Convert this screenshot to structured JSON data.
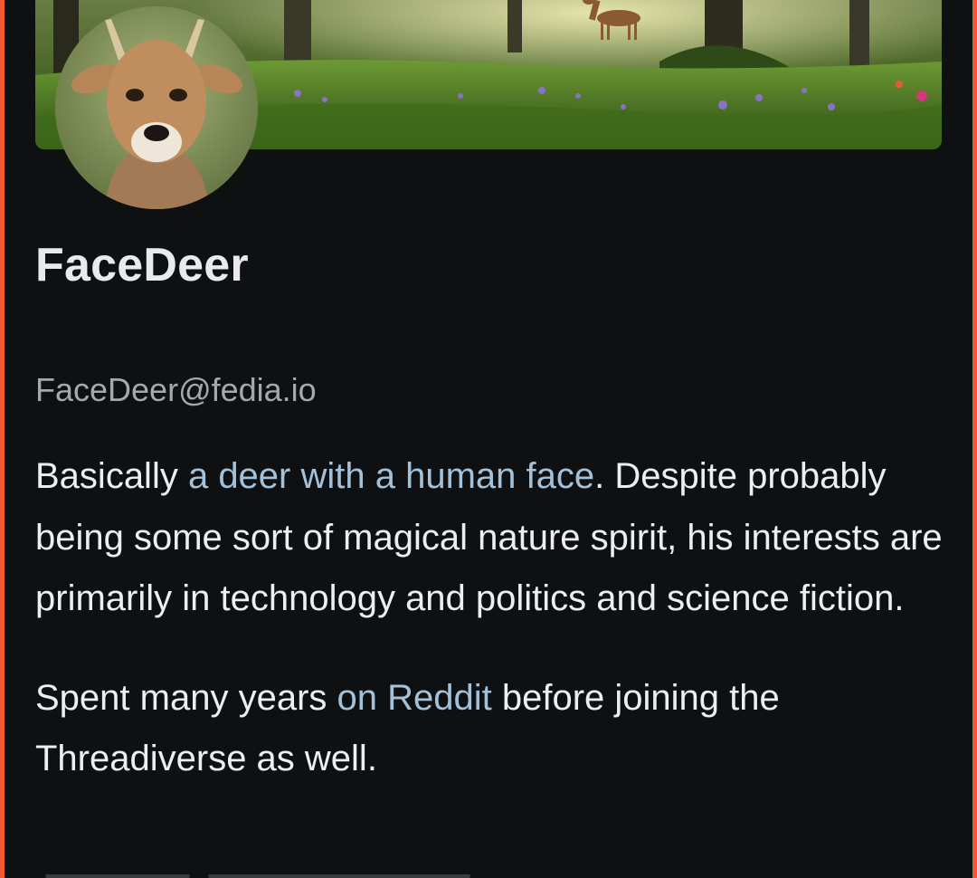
{
  "profile": {
    "display_name": "FaceDeer",
    "handle": "FaceDeer@fedia.io",
    "banner_image": "forest-deer-banner",
    "avatar_image": "deer-face-avatar"
  },
  "bio": {
    "p1_text_1": "Basically ",
    "p1_link": "a deer with a human face",
    "p1_text_2": ". Despite probably being some sort of magical nature spirit, his interests are primarily in technology and politics and science fiction.",
    "p2_text_1": "Spent many years ",
    "p2_link": "on Reddit",
    "p2_text_2": " before joining the Threadiverse as well."
  },
  "colors": {
    "background": "#0f1012",
    "accent_frame": "#ef5a32",
    "link": "#a3c2d9",
    "text": "#eceef1",
    "muted": "#a6a8ad"
  }
}
